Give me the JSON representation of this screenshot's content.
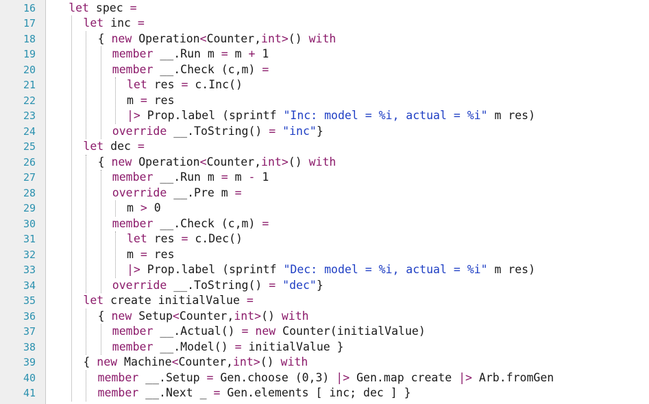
{
  "editor": {
    "first_line_number": 16,
    "line_numbers": [
      "16",
      "17",
      "18",
      "19",
      "20",
      "21",
      "22",
      "23",
      "24",
      "25",
      "26",
      "27",
      "28",
      "29",
      "30",
      "31",
      "32",
      "33",
      "34",
      "35",
      "36",
      "37",
      "38",
      "39",
      "40",
      "41"
    ],
    "lines": [
      {
        "indent": 2,
        "tokens": [
          {
            "t": "let",
            "c": "kw"
          },
          {
            "t": " spec "
          },
          {
            "t": "=",
            "c": "op"
          }
        ]
      },
      {
        "indent": 4,
        "tokens": [
          {
            "t": "let",
            "c": "kw"
          },
          {
            "t": " inc "
          },
          {
            "t": "=",
            "c": "op"
          }
        ]
      },
      {
        "indent": 6,
        "tokens": [
          {
            "t": "{ "
          },
          {
            "t": "new",
            "c": "kw"
          },
          {
            "t": " Operation"
          },
          {
            "t": "<",
            "c": "op"
          },
          {
            "t": "Counter,"
          },
          {
            "t": "int",
            "c": "kw"
          },
          {
            "t": ">",
            "c": "op"
          },
          {
            "t": "() "
          },
          {
            "t": "with",
            "c": "kw"
          }
        ]
      },
      {
        "indent": 8,
        "tokens": [
          {
            "t": "member",
            "c": "kw"
          },
          {
            "t": " __.Run m "
          },
          {
            "t": "=",
            "c": "op"
          },
          {
            "t": " m "
          },
          {
            "t": "+",
            "c": "op"
          },
          {
            "t": " 1"
          }
        ]
      },
      {
        "indent": 8,
        "tokens": [
          {
            "t": "member",
            "c": "kw"
          },
          {
            "t": " __.Check (c,m) "
          },
          {
            "t": "=",
            "c": "op"
          }
        ]
      },
      {
        "indent": 10,
        "tokens": [
          {
            "t": "let",
            "c": "kw"
          },
          {
            "t": " res "
          },
          {
            "t": "=",
            "c": "op"
          },
          {
            "t": " c.Inc()"
          }
        ]
      },
      {
        "indent": 10,
        "tokens": [
          {
            "t": "m "
          },
          {
            "t": "=",
            "c": "op"
          },
          {
            "t": " res"
          }
        ]
      },
      {
        "indent": 10,
        "tokens": [
          {
            "t": "|>",
            "c": "op"
          },
          {
            "t": " Prop.label (sprintf "
          },
          {
            "t": "\"Inc: model = %i, actual = %i\"",
            "c": "str"
          },
          {
            "t": " m res)"
          }
        ]
      },
      {
        "indent": 8,
        "tokens": [
          {
            "t": "override",
            "c": "kw"
          },
          {
            "t": " __.ToString() "
          },
          {
            "t": "=",
            "c": "op"
          },
          {
            "t": " "
          },
          {
            "t": "\"inc\"",
            "c": "str"
          },
          {
            "t": "}"
          }
        ]
      },
      {
        "indent": 4,
        "tokens": [
          {
            "t": "let",
            "c": "kw"
          },
          {
            "t": " dec "
          },
          {
            "t": "=",
            "c": "op"
          }
        ]
      },
      {
        "indent": 6,
        "tokens": [
          {
            "t": "{ "
          },
          {
            "t": "new",
            "c": "kw"
          },
          {
            "t": " Operation"
          },
          {
            "t": "<",
            "c": "op"
          },
          {
            "t": "Counter,"
          },
          {
            "t": "int",
            "c": "kw"
          },
          {
            "t": ">",
            "c": "op"
          },
          {
            "t": "() "
          },
          {
            "t": "with",
            "c": "kw"
          }
        ]
      },
      {
        "indent": 8,
        "tokens": [
          {
            "t": "member",
            "c": "kw"
          },
          {
            "t": " __.Run m "
          },
          {
            "t": "=",
            "c": "op"
          },
          {
            "t": " m "
          },
          {
            "t": "-",
            "c": "op"
          },
          {
            "t": " 1"
          }
        ]
      },
      {
        "indent": 8,
        "tokens": [
          {
            "t": "override",
            "c": "kw"
          },
          {
            "t": " __.Pre m "
          },
          {
            "t": "=",
            "c": "op"
          }
        ]
      },
      {
        "indent": 10,
        "tokens": [
          {
            "t": "m "
          },
          {
            "t": ">",
            "c": "op"
          },
          {
            "t": " 0"
          }
        ]
      },
      {
        "indent": 8,
        "tokens": [
          {
            "t": "member",
            "c": "kw"
          },
          {
            "t": " __.Check (c,m) "
          },
          {
            "t": "=",
            "c": "op"
          }
        ]
      },
      {
        "indent": 10,
        "tokens": [
          {
            "t": "let",
            "c": "kw"
          },
          {
            "t": " res "
          },
          {
            "t": "=",
            "c": "op"
          },
          {
            "t": " c.Dec()"
          }
        ]
      },
      {
        "indent": 10,
        "tokens": [
          {
            "t": "m "
          },
          {
            "t": "=",
            "c": "op"
          },
          {
            "t": " res"
          }
        ]
      },
      {
        "indent": 10,
        "tokens": [
          {
            "t": "|>",
            "c": "op"
          },
          {
            "t": " Prop.label (sprintf "
          },
          {
            "t": "\"Dec: model = %i, actual = %i\"",
            "c": "str"
          },
          {
            "t": " m res)"
          }
        ]
      },
      {
        "indent": 8,
        "tokens": [
          {
            "t": "override",
            "c": "kw"
          },
          {
            "t": " __.ToString() "
          },
          {
            "t": "=",
            "c": "op"
          },
          {
            "t": " "
          },
          {
            "t": "\"dec\"",
            "c": "str"
          },
          {
            "t": "}"
          }
        ]
      },
      {
        "indent": 4,
        "tokens": [
          {
            "t": "let",
            "c": "kw"
          },
          {
            "t": " create initialValue "
          },
          {
            "t": "=",
            "c": "op"
          }
        ]
      },
      {
        "indent": 6,
        "tokens": [
          {
            "t": "{ "
          },
          {
            "t": "new",
            "c": "kw"
          },
          {
            "t": " Setup"
          },
          {
            "t": "<",
            "c": "op"
          },
          {
            "t": "Counter,"
          },
          {
            "t": "int",
            "c": "kw"
          },
          {
            "t": ">",
            "c": "op"
          },
          {
            "t": "() "
          },
          {
            "t": "with",
            "c": "kw"
          }
        ]
      },
      {
        "indent": 8,
        "tokens": [
          {
            "t": "member",
            "c": "kw"
          },
          {
            "t": " __.Actual() "
          },
          {
            "t": "=",
            "c": "op"
          },
          {
            "t": " "
          },
          {
            "t": "new",
            "c": "kw"
          },
          {
            "t": " Counter(initialValue)"
          }
        ]
      },
      {
        "indent": 8,
        "tokens": [
          {
            "t": "member",
            "c": "kw"
          },
          {
            "t": " __.Model() "
          },
          {
            "t": "=",
            "c": "op"
          },
          {
            "t": " initialValue }"
          }
        ]
      },
      {
        "indent": 4,
        "tokens": [
          {
            "t": "{ "
          },
          {
            "t": "new",
            "c": "kw"
          },
          {
            "t": " Machine"
          },
          {
            "t": "<",
            "c": "op"
          },
          {
            "t": "Counter,"
          },
          {
            "t": "int",
            "c": "kw"
          },
          {
            "t": ">",
            "c": "op"
          },
          {
            "t": "() "
          },
          {
            "t": "with",
            "c": "kw"
          }
        ]
      },
      {
        "indent": 6,
        "tokens": [
          {
            "t": "member",
            "c": "kw"
          },
          {
            "t": " __.Setup "
          },
          {
            "t": "=",
            "c": "op"
          },
          {
            "t": " Gen.choose (0,3) "
          },
          {
            "t": "|>",
            "c": "op"
          },
          {
            "t": " Gen.map create "
          },
          {
            "t": "|>",
            "c": "op"
          },
          {
            "t": " Arb.fromGen"
          }
        ]
      },
      {
        "indent": 6,
        "tokens": [
          {
            "t": "member",
            "c": "kw"
          },
          {
            "t": " __.Next _ "
          },
          {
            "t": "=",
            "c": "op"
          },
          {
            "t": " Gen.elements [ inc; dec ] }"
          }
        ]
      }
    ]
  },
  "colors": {
    "keyword": "#8b1a6a",
    "string": "#1f3fc4",
    "line_number": "#2b91af",
    "gutter_bg": "#efefef"
  }
}
